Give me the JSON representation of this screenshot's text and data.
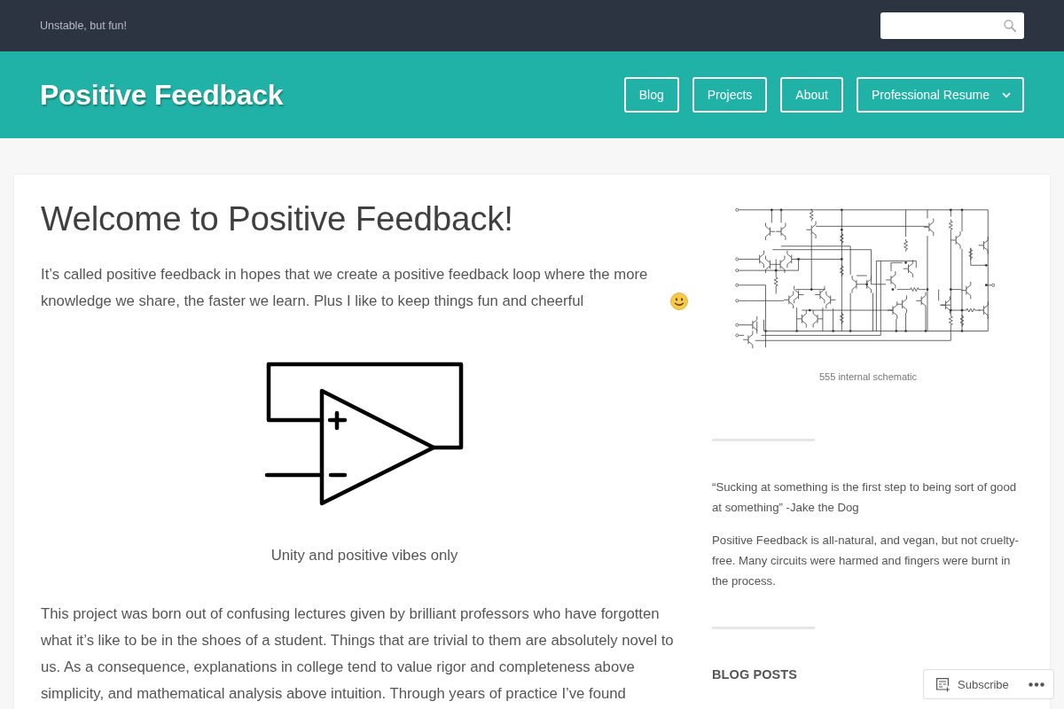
{
  "top_bar": {
    "tagline": "Unstable, but fun!"
  },
  "header": {
    "site_title": "Positive Feedback",
    "nav": [
      {
        "label": "Blog",
        "submenu": false
      },
      {
        "label": "Projects",
        "submenu": false
      },
      {
        "label": "About",
        "submenu": false
      },
      {
        "label": "Professional Resume",
        "submenu": true
      }
    ]
  },
  "post": {
    "title": "Welcome to Positive Feedback!",
    "intro": "It’s called positive feedback in hopes that we create a positive feedback loop where the more knowledge we share, the faster we learn. Plus I like to keep things fun and cheerful",
    "figure": {
      "caption": "Unity and positive vibes only"
    },
    "body": "This project was born out of confusing lectures given by brilliant professors who have forgotten what it’s like to be in the shoes of a student. Things that are trivial to them are absolutely novel to us. As a consequence, explanations in college tend to value rigor and completeness above simplicity, and mathematical analysis above intuition. Through years of practice I’ve found"
  },
  "sidebar": {
    "image": {
      "caption": "555 internal schematic"
    },
    "quote": "“Sucking at something is the first step to being sort of good at something” -Jake the Dog",
    "about": "Positive Feedback is all-natural, and vegan, but not cruelty-free. Many circuits were harmed and fingers were burnt in the process.",
    "section_title": "BLOG POSTS"
  },
  "subscribe": {
    "label": "Subscribe"
  }
}
